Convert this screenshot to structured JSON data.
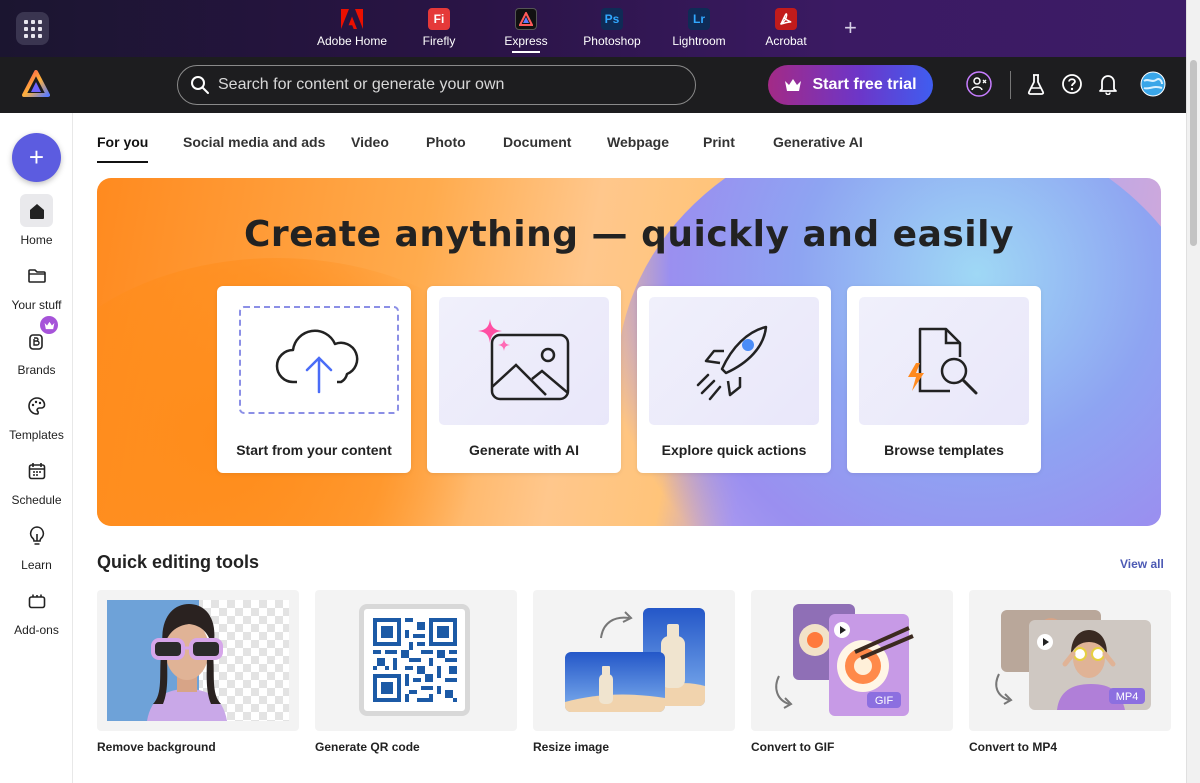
{
  "topbar": {
    "apps": [
      {
        "name": "Adobe Home",
        "badge": "A",
        "color": "#eb1000"
      },
      {
        "name": "Firefly",
        "badge": "Fi",
        "color": "#e53939"
      },
      {
        "name": "Express",
        "badge": "A",
        "color": "#1a1a1a"
      },
      {
        "name": "Photoshop",
        "badge": "Ps",
        "color": "#0f2b56"
      },
      {
        "name": "Lightroom",
        "badge": "Lr",
        "color": "#0f2b56"
      },
      {
        "name": "Acrobat",
        "badge": "A",
        "color": "#c21b1b"
      }
    ],
    "active_app": "Express",
    "add_app": "+"
  },
  "navbar": {
    "search_placeholder": "Search for content or generate your own",
    "trial_label": "Start free trial"
  },
  "sidebar": {
    "create": "+",
    "items": [
      {
        "label": "Home",
        "icon": "home-icon"
      },
      {
        "label": "Your stuff",
        "icon": "folder-icon"
      },
      {
        "label": "Brands",
        "icon": "brand-icon"
      },
      {
        "label": "Templates",
        "icon": "templates-icon"
      },
      {
        "label": "Schedule",
        "icon": "calendar-icon"
      },
      {
        "label": "Learn",
        "icon": "lightbulb-icon"
      },
      {
        "label": "Add-ons",
        "icon": "addons-icon"
      }
    ]
  },
  "tabs": [
    "For you",
    "Social media and ads",
    "Video",
    "Photo",
    "Document",
    "Webpage",
    "Print",
    "Generative AI"
  ],
  "hero": {
    "title": "Create anything — quickly and easily",
    "cards": [
      {
        "label": "Start from your content",
        "icon": "cloud-upload-icon"
      },
      {
        "label": "Generate with AI",
        "icon": "ai-image-icon"
      },
      {
        "label": "Explore quick actions",
        "icon": "rocket-icon"
      },
      {
        "label": "Browse templates",
        "icon": "template-search-icon"
      }
    ]
  },
  "quick_tools": {
    "title": "Quick editing tools",
    "view_all": "View all",
    "items": [
      {
        "label": "Remove background"
      },
      {
        "label": "Generate QR code"
      },
      {
        "label": "Resize image"
      },
      {
        "label": "Convert to GIF",
        "badge": "GIF"
      },
      {
        "label": "Convert to MP4",
        "badge": "MP4"
      }
    ]
  }
}
